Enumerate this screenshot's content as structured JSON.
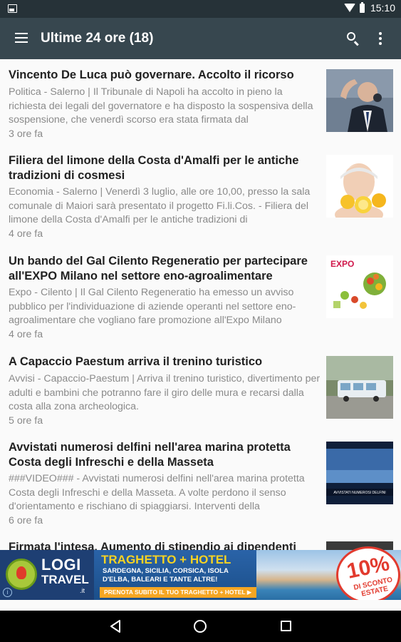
{
  "status_bar": {
    "time": "15:10"
  },
  "toolbar": {
    "title": "Ultime 24 ore (18)"
  },
  "articles": [
    {
      "headline": "Vincento De Luca può governare. Accolto il ricorso",
      "summary": "Politica - Salerno | Il Tribunale di Napoli ha accolto in pieno la richiesta dei legali del governatore e ha disposto la sospensiva della sospensione, che venerdì scorso era stata firmata dal",
      "time": "3 ore fa"
    },
    {
      "headline": "Filiera del limone della Costa d'Amalfi per le antiche tradizioni di cosmesi",
      "summary": "Economia - Salerno | Venerdì 3 luglio, alle ore 10,00, presso la sala comunale di Maiori sarà presentato il progetto Fi.li.Cos. - Filiera del limone della Costa d'Amalfi per le antiche tradizioni di",
      "time": "4 ore fa"
    },
    {
      "headline": "Un bando del Gal Cilento Regeneratio per partecipare all'EXPO Milano nel settore eno-agroalimentare",
      "summary": "Expo - Cilento | Il Gal Cilento Regeneratio ha emesso un avviso pubblico per l'individuazione di aziende operanti nel settore eno-agroalimentare che vogliano fare promozione all'Expo Milano",
      "time": "4 ore fa"
    },
    {
      "headline": "A Capaccio Paestum arriva il trenino turistico",
      "summary": "Avvisi - Capaccio-Paestum | Arriva il trenino turistico, divertimento per adulti e bambini che potranno fare il giro delle mura e recarsi dalla costa alla zona archeologica.",
      "time": "5 ore fa"
    },
    {
      "headline": "Avvistati numerosi delfini nell'area marina protetta Costa degli Infreschi e della Masseta",
      "summary": "###VIDEO### - Avvistati numerosi delfini nell'area marina protetta Costa degli Infreschi e della Masseta. A volte perdono il senso d'orientamento e rischiano di spiaggiarsi. Interventi della",
      "time": "6 ore fa"
    },
    {
      "headline": "Firmata l'intesa. Aumento di stipendio ai dipendenti",
      "summary": "",
      "time": ""
    }
  ],
  "thumbnails": {
    "expo_logo": "EXPO",
    "video_caption": "AVVISTATI NUMEROSI DELFINI"
  },
  "ad": {
    "brand_line1": "LOGI",
    "brand_line2": "TRAVEL",
    "brand_domain": ".it",
    "promo_title": "TRAGHETTO + HOTEL",
    "promo_destinations": "SARDEGNA, SICILIA, CORSICA, ISOLA D'ELBA, BALEARI E TANTE ALTRE!",
    "promo_cta": "PRENOTA SUBITO IL TUO TRAGHETTO + HOTEL ▶",
    "badge_percent": "10%",
    "badge_label": "DI SCONTO ESTATE",
    "info": "i"
  },
  "colors": {
    "status_bar": "#263238",
    "toolbar": "#37474f",
    "headline": "#212121",
    "summary": "#8a8a8a",
    "ad_accent": "#f7d322",
    "badge_red": "#e23a2e"
  }
}
